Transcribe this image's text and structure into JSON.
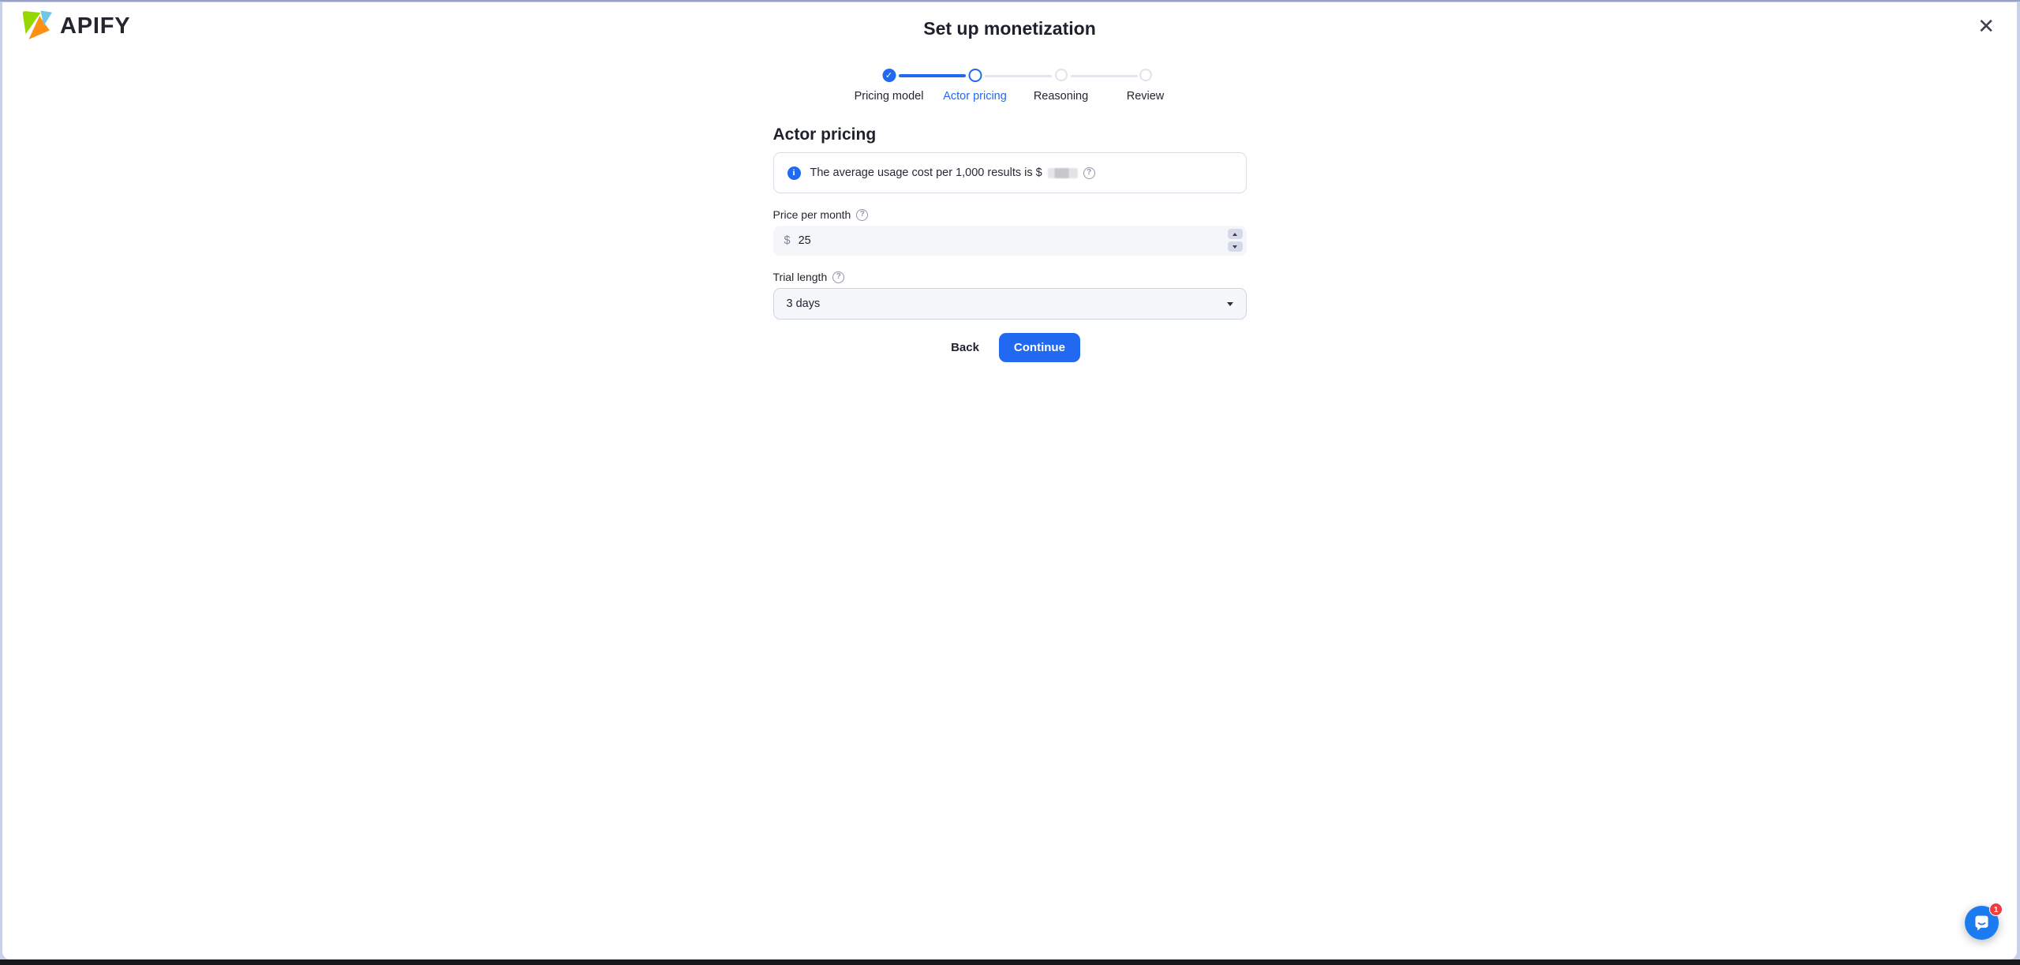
{
  "header": {
    "brand": "APIFY",
    "title": "Set up monetization",
    "close_glyph": "✕"
  },
  "stepper": {
    "steps": [
      {
        "label": "Pricing model",
        "state": "done"
      },
      {
        "label": "Actor pricing",
        "state": "active"
      },
      {
        "label": "Reasoning",
        "state": "upcoming"
      },
      {
        "label": "Review",
        "state": "upcoming"
      }
    ],
    "check_glyph": "✓"
  },
  "form": {
    "heading": "Actor pricing",
    "banner": {
      "info_glyph": "i",
      "text": "The average usage cost per 1,000 results is $",
      "value_redacted": true,
      "help_glyph": "?"
    },
    "price": {
      "label": "Price per month",
      "help_glyph": "?",
      "currency": "$",
      "value": "25"
    },
    "trial": {
      "label": "Trial length",
      "help_glyph": "?",
      "selected_option": "3 days"
    },
    "back_label": "Back",
    "continue_label": "Continue"
  },
  "chat": {
    "badge_count": "1"
  },
  "colors": {
    "accent_blue": "#2069f0",
    "chat_blue": "#1c7bf0",
    "badge_red": "#f23b3b",
    "backdrop_lavender": "#c9d0e9",
    "bottom_bar_dark": "#17181c",
    "field_bg": "#f4f6fa",
    "border": "#d9ddea",
    "text_dark": "#1e212b",
    "text_gray": "#7b8299",
    "logo_green": "#97d700",
    "logo_orange": "#ff9013",
    "logo_blue": "#71c5e8"
  }
}
